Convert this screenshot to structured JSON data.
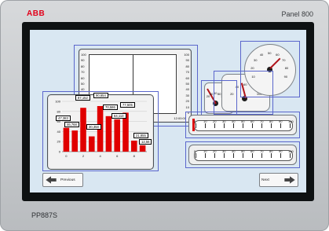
{
  "header": {
    "brand": "ABB",
    "model": "Panel 800"
  },
  "footer": {
    "model_code": "PP887S"
  },
  "buttons": {
    "previous_label": "Previous",
    "next_label": "Next"
  },
  "trend_panel": {
    "left_ticks": [
      "100",
      "90",
      "80",
      "70",
      "60",
      "50",
      "40",
      "30",
      "20",
      "10",
      "0"
    ],
    "right_ticks": [
      "100",
      "90",
      "80",
      "70",
      "60",
      "50",
      "40",
      "30",
      "20",
      "10",
      "0"
    ],
    "bottom_right_label": "12:00:00"
  },
  "bar_panel": {
    "tags": [
      "87,152",
      "90,654",
      "47,383",
      "46,768",
      "70,586",
      "77,505",
      "30,358",
      "64,113",
      "21,855",
      "12,56"
    ],
    "chart_data": {
      "type": "bar",
      "categories": [
        "0",
        "1",
        "2",
        "3",
        "4",
        "5",
        "6",
        "7",
        "8",
        "9"
      ],
      "values": [
        47.383,
        42.0,
        87.152,
        30.358,
        90.654,
        70.586,
        64.113,
        77.505,
        21.855,
        12.56
      ],
      "ylim": [
        0,
        100
      ],
      "y_ticks": [
        "100",
        "80",
        "60",
        "40",
        "20",
        "0"
      ],
      "x_ticks": [
        "0",
        "2",
        "4",
        "6",
        "8"
      ],
      "title": "",
      "xlabel": "",
      "ylabel": ""
    }
  },
  "gauges": {
    "g1": {
      "labels": [
        "20",
        "40",
        "60",
        "80",
        "100"
      ],
      "value": 65
    },
    "g2": {
      "labels": [
        "20",
        "40",
        "60",
        "80",
        "100"
      ],
      "value": 55
    },
    "g3": {
      "labels": [
        "10",
        "20",
        "30",
        "40",
        "50",
        "60",
        "70",
        "80",
        "90"
      ],
      "value": 70
    }
  },
  "linear": {
    "top": {
      "labels": [
        "0",
        "10",
        "20",
        "30",
        "40",
        "50",
        "60",
        "70",
        "80",
        "90",
        "100"
      ],
      "value": 0
    },
    "bottom": {
      "labels": [
        "0",
        "10",
        "20",
        "30",
        "40",
        "50",
        "60",
        "70",
        "80",
        "90",
        "100"
      ]
    }
  }
}
